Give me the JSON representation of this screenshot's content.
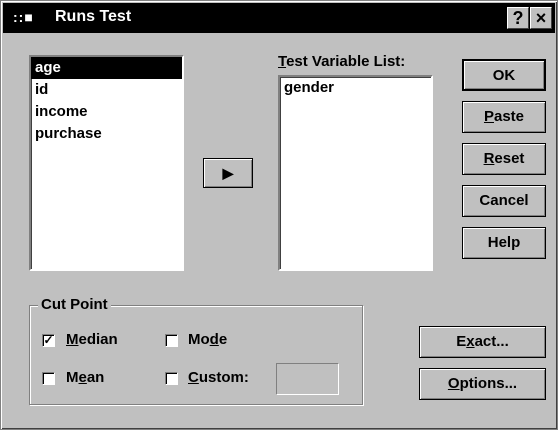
{
  "window": {
    "title": "Runs Test",
    "sysmenu_glyph": "::■",
    "help_button": "?",
    "close_button": "×"
  },
  "variables": {
    "items": [
      {
        "label": "age",
        "selected": true
      },
      {
        "label": "id",
        "selected": false
      },
      {
        "label": "income",
        "selected": false
      },
      {
        "label": "purchase",
        "selected": false
      }
    ]
  },
  "move_button": {
    "glyph": "▶"
  },
  "test_variable_list": {
    "label_mnemonic": "T",
    "label_rest": "est Variable List:",
    "items": [
      {
        "label": "gender"
      }
    ]
  },
  "buttons": {
    "ok": "OK",
    "paste_m": "P",
    "paste_rest": "aste",
    "reset_m": "R",
    "reset_rest": "eset",
    "cancel": "Cancel",
    "help": "Help",
    "exact_pre": "E",
    "exact_m": "x",
    "exact_rest": "act...",
    "options_m": "O",
    "options_rest": "ptions..."
  },
  "cut_point": {
    "legend": "Cut Point",
    "median": {
      "m": "M",
      "rest": "edian",
      "checked": true
    },
    "mode": {
      "pre": "Mo",
      "m": "d",
      "rest": "e",
      "checked": false
    },
    "mean": {
      "pre": "M",
      "m": "e",
      "rest": "an",
      "checked": false
    },
    "custom": {
      "m": "C",
      "rest": "ustom:",
      "checked": false,
      "value": ""
    }
  },
  "check_glyph": "✓",
  "colors": {
    "face": "#c0c0c0",
    "titlebar": "#000000",
    "selection": "#000000"
  }
}
